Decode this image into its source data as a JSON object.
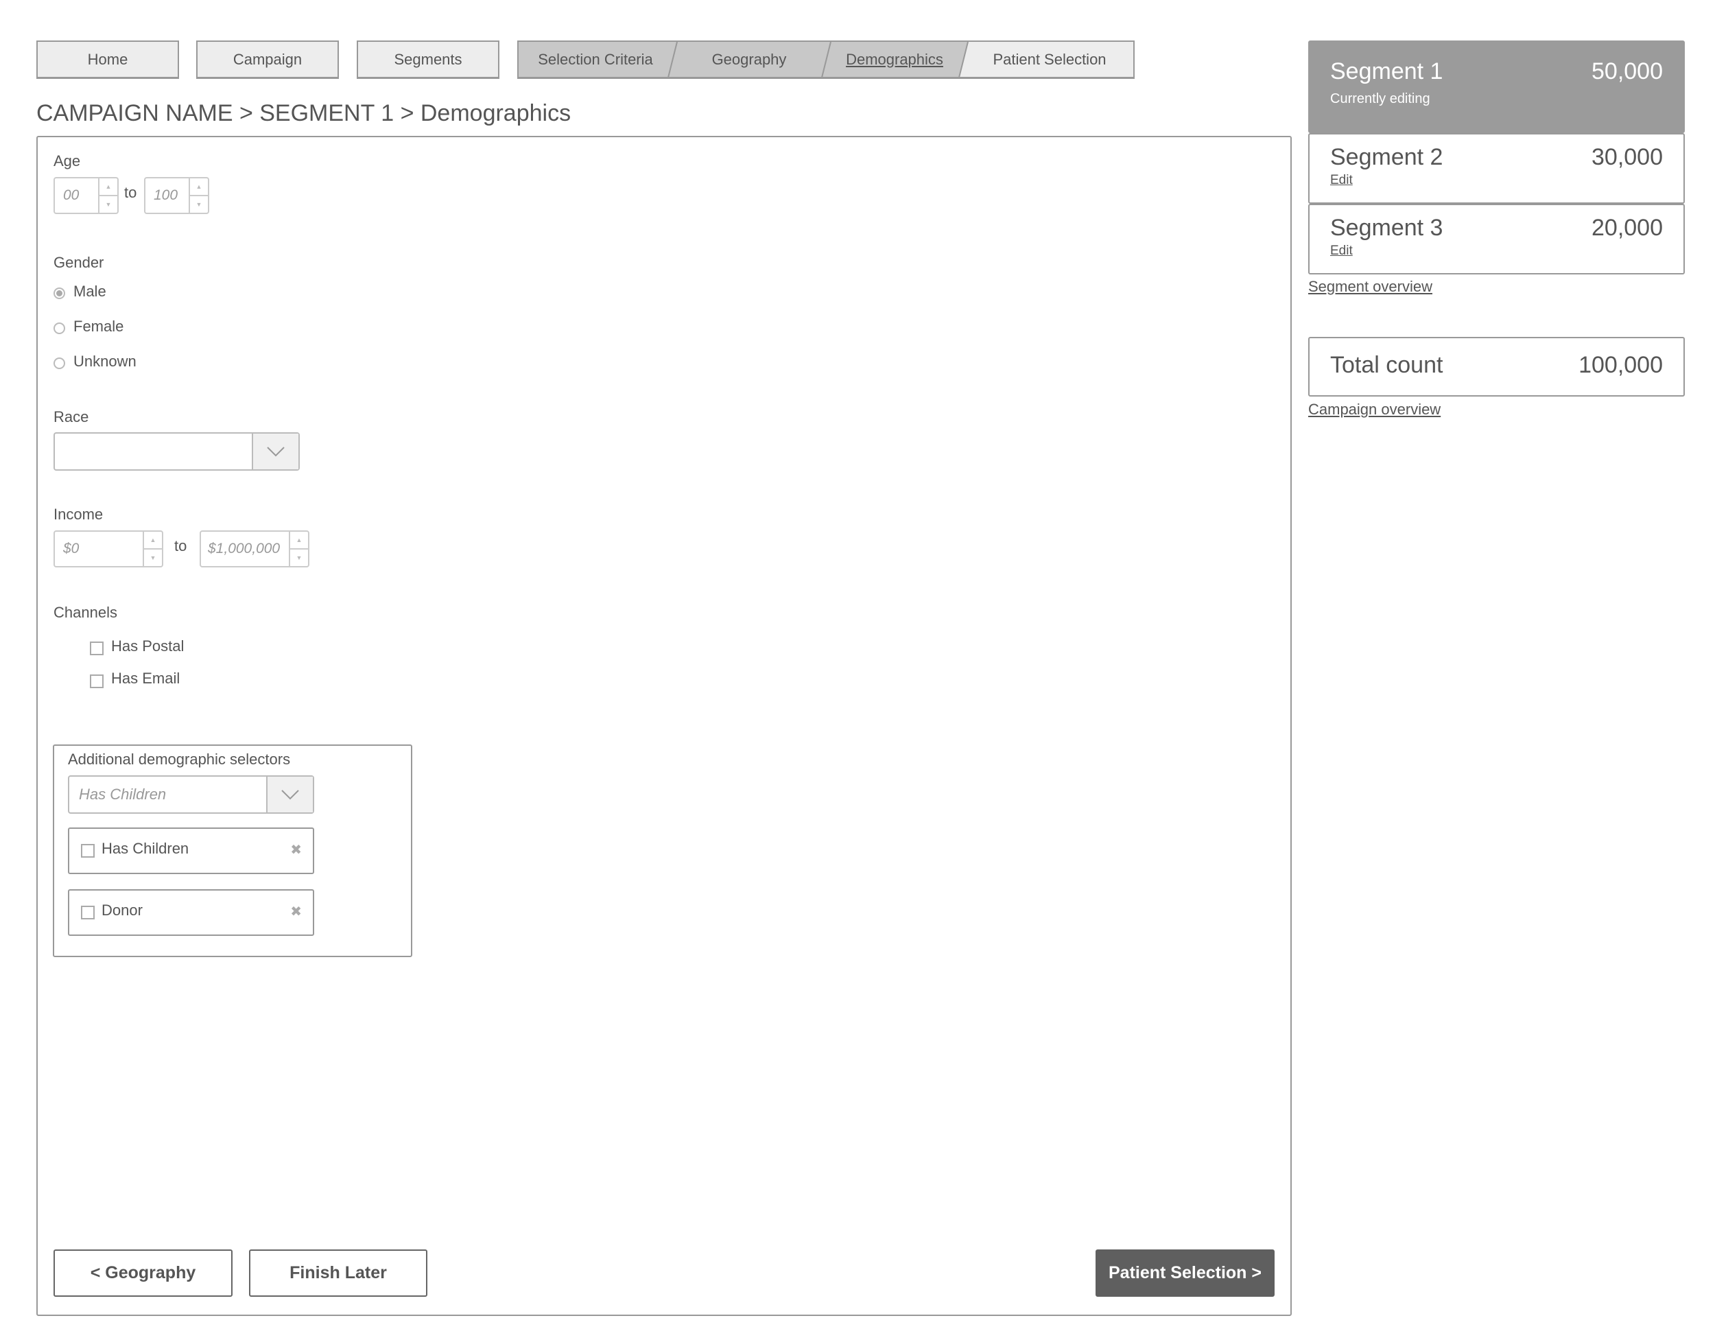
{
  "nav": {
    "home": "Home",
    "campaign": "Campaign",
    "segments": "Segments"
  },
  "steps": [
    {
      "label": "Selection Criteria"
    },
    {
      "label": "Geography"
    },
    {
      "label": "Demographics"
    },
    {
      "label": "Patient Selection"
    }
  ],
  "breadcrumb": "CAMPAIGN NAME > SEGMENT 1 > Demographics",
  "form": {
    "age": {
      "label": "Age",
      "from": "00",
      "to_label": "to",
      "to": "100"
    },
    "gender": {
      "label": "Gender",
      "options": [
        "Male",
        "Female",
        "Unknown"
      ],
      "selected": "Male"
    },
    "race": {
      "label": "Race",
      "value": ""
    },
    "income": {
      "label": "Income",
      "from": "$0",
      "to_label": "to",
      "to": "$1,000,000"
    },
    "channels": {
      "label": "Channels",
      "options": [
        "Has Postal",
        "Has Email"
      ]
    },
    "additional": {
      "title": "Additional demographic selectors",
      "select_value": "Has Children",
      "items": [
        "Has Children",
        "Donor"
      ]
    }
  },
  "buttons": {
    "back": "< Geography",
    "finish": "Finish Later",
    "next": "Patient Selection >"
  },
  "sidebar": {
    "segments": [
      {
        "name": "Segment 1",
        "count": "50,000",
        "sub": "Currently editing"
      },
      {
        "name": "Segment 2",
        "count": "30,000",
        "sub": "Edit"
      },
      {
        "name": "Segment 3",
        "count": "20,000",
        "sub": "Edit"
      }
    ],
    "segment_overview": "Segment overview",
    "total_label": "Total count",
    "total": "100,000",
    "campaign_overview": "Campaign overview"
  },
  "colors": {
    "active_segment": "#9b9b9b",
    "primary_button": "#5f5f5f",
    "step_done": "#c8c8c8"
  }
}
